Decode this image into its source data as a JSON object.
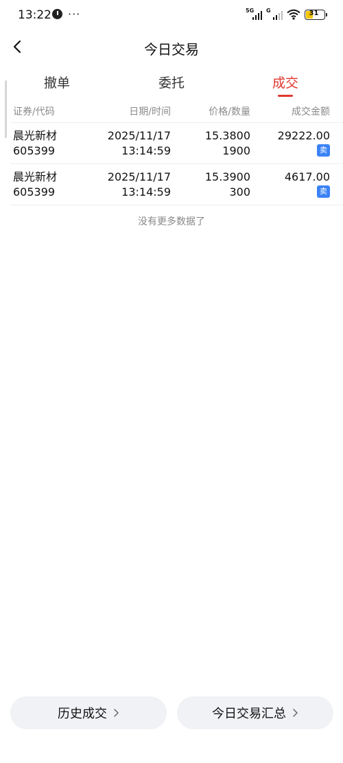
{
  "status_bar": {
    "time": "13:22",
    "more": "···",
    "network_1": "5G",
    "network_2": "G",
    "battery": "31"
  },
  "header": {
    "title": "今日交易"
  },
  "tabs": [
    {
      "label": "撤单",
      "active": false
    },
    {
      "label": "委托",
      "active": false
    },
    {
      "label": "成交",
      "active": true
    }
  ],
  "table": {
    "headers": [
      "证券/代码",
      "日期/时间",
      "价格/数量",
      "成交金额"
    ],
    "rows": [
      {
        "name": "晨光新材",
        "code": "605399",
        "date": "2025/11/17",
        "time": "13:14:59",
        "price": "15.3800",
        "qty": "1900",
        "amount": "29222.00",
        "side": "卖"
      },
      {
        "name": "晨光新材",
        "code": "605399",
        "date": "2025/11/17",
        "time": "13:14:59",
        "price": "15.3900",
        "qty": "300",
        "amount": "4617.00",
        "side": "卖"
      }
    ],
    "empty_hint": "没有更多数据了"
  },
  "bottom": {
    "history_label": "历史成交",
    "summary_label": "今日交易汇总"
  },
  "colors": {
    "accent": "#e0372f",
    "sell_badge": "#3b82f6"
  }
}
